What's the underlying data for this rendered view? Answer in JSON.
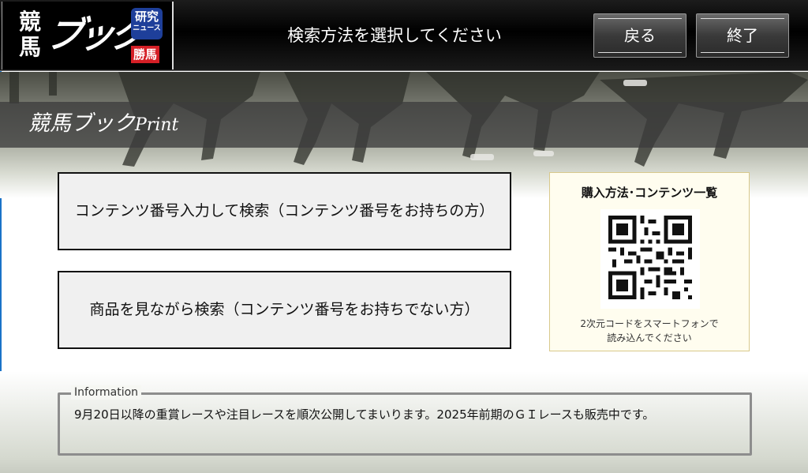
{
  "header": {
    "logo": {
      "keiba": "競馬",
      "book": "ブック",
      "kenkyu_top": "研究",
      "kenkyu_bottom": "ニュース",
      "kachiuma": "勝馬"
    },
    "title": "検索方法を選択してください",
    "back_label": "戻る",
    "end_label": "終了"
  },
  "banner": {
    "title_jp": "競馬ブック",
    "title_en": "Print"
  },
  "main": {
    "search_by_number_label": "コンテンツ番号入力して検索（コンテンツ番号をお持ちの方）",
    "search_by_browse_label": "商品を見ながら検索（コンテンツ番号をお持ちでない方）"
  },
  "qr_panel": {
    "title": "購入方法･コンテンツ一覧",
    "caption_line1": "2次元コードをスマートフォンで",
    "caption_line2": "読み込んでください"
  },
  "information": {
    "legend": "Information",
    "text": "9月20日以降の重賞レースや注目レースを順次公開してまいります。2025年前期のＧＩレースも販売中です。"
  },
  "colors": {
    "header_bg": "#000000",
    "kenkyu_blue": "#1e3f9a",
    "kachiuma_red": "#d51f26",
    "qr_panel_bg": "#fffdef"
  }
}
